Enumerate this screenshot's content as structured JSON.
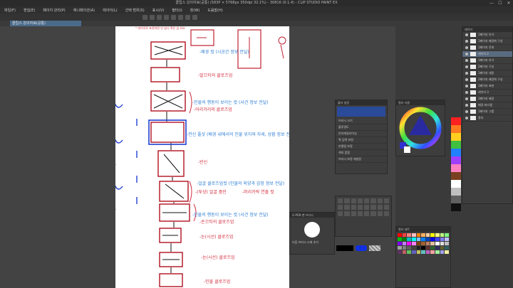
{
  "window": {
    "title": "클립스 강의자료(공통) (583P × 5768px 350dpi 32.1%) - 30816 (0.1.4) - CLIP STUDIO PAINT EX",
    "minimize": "—",
    "maximize": "☐",
    "close": "✕"
  },
  "menu": {
    "items": [
      "파일(F)",
      "편집(E)",
      "페이지 관리(P)",
      "애니메이션(A)",
      "레이어(L)",
      "선택 범위(S)",
      "표시(V)",
      "필터(I)",
      "창(W)",
      "도움말(H)"
    ]
  },
  "document_tab": {
    "label": "클립스 강의자료(공통)"
  },
  "canvas_notes": {
    "top_note": "* 레이어로 표현하면 안 없다 혹은 없 외요",
    "blue": [
      "-배경 컷 (시공간 정보 전달)",
      "-인물의 행동이 보이는 컷 (사건 정보 전달)",
      "-전신 풀샷 (배경 내에서의 인물 위치와 자세, 상황 정보 전달)",
      "-얼굴 클로즈업컷 (인물의 외양과 감정 정보 전달)",
      "-인물의 행동이 보이는 컷 (사건 정보 전달)"
    ],
    "red": [
      "-발끄티의 클로즈업",
      "-어리거리의 클로즈업",
      "-반신",
      "-(투샷) 얼굴 줌인",
      "-머리카락 연출 컷",
      "-손끄티의 클로즈업",
      "-눈(시선) 클로즈업",
      "-눈(시선) 클로즈업",
      "-인물 클로즈업"
    ]
  },
  "brush_panel": {
    "title": "블러 설정",
    "rows": [
      "브러시 크기",
      "불투명도",
      "안티에일리어싱",
      "획 입력 보정",
      "손떨림 보정",
      "색의 혼합",
      "브러시 보정 재설정"
    ]
  },
  "color_panel": {
    "title": "컬러 서클",
    "main_color": "#3030d0",
    "sub_color": "#ffffff"
  },
  "brush_preview": {
    "name": "G-PEN 펜 브러시",
    "preview_label": "다음 브러시 소재 추가"
  },
  "color_strip": {
    "colors": [
      "#ff2020",
      "#ff7a20",
      "#ffd020",
      "#40c040",
      "#2080ff",
      "#a040ff",
      "#ff80c0",
      "#7a4020",
      "#ffffff",
      "#c0c0c0",
      "#606060",
      "#101010"
    ]
  },
  "layers": {
    "title": "레이어",
    "items": [
      {
        "label": "1페이지 아가",
        "selected": false
      },
      {
        "label": "1페이지 배경화 구성",
        "selected": false
      },
      {
        "label": "1페이지 전개",
        "selected": false
      },
      {
        "label": "레이어 2",
        "selected": true
      },
      {
        "label": "1페이지 아가",
        "selected": false
      },
      {
        "label": "2페이지 구성",
        "selected": false
      },
      {
        "label": "1페이지 내용",
        "selected": false
      },
      {
        "label": "2페이지 배경화 구성",
        "selected": false
      },
      {
        "label": "1페이지 표현",
        "selected": false
      },
      {
        "label": "레이어 3",
        "selected": false
      },
      {
        "label": "2페이지 배경",
        "selected": false
      },
      {
        "label": "배경 파스텔",
        "selected": false
      },
      {
        "label": "1페이지 그룹",
        "selected": false
      },
      {
        "label": "용지",
        "selected": false
      }
    ]
  },
  "palette": {
    "title": "컬러 세트",
    "colors": [
      "#ff0000",
      "#ff4040",
      "#ff8080",
      "#ffc0c0",
      "#ff8000",
      "#ffb060",
      "#ffd0a0",
      "#ffff00",
      "#ffff80",
      "#c0ff80",
      "#80ff80",
      "#00c000",
      "#008000",
      "#00c0c0",
      "#00ffff",
      "#80c0ff",
      "#0080ff",
      "#0040c0",
      "#0000ff",
      "#4040ff",
      "#8080ff",
      "#c0c0ff",
      "#8000ff",
      "#c080ff",
      "#ff00ff",
      "#ff80ff",
      "#804000",
      "#a06030",
      "#c08060",
      "#e0c0a0",
      "#ffffff",
      "#e0e0e0",
      "#c0c0c0",
      "#a0a0a0",
      "#808080",
      "#606060",
      "#404040",
      "#202020",
      "#000000",
      "#603030",
      "#306030",
      "#303060",
      "#606030",
      "#306060",
      "#603060",
      "#c06060",
      "#60c060",
      "#6060c0",
      "#c0c060",
      "#60c0c0",
      "#c060c0",
      "#f0a0a0",
      "#a0f0a0",
      "#a0a0f0",
      "#f0f0a0"
    ]
  }
}
